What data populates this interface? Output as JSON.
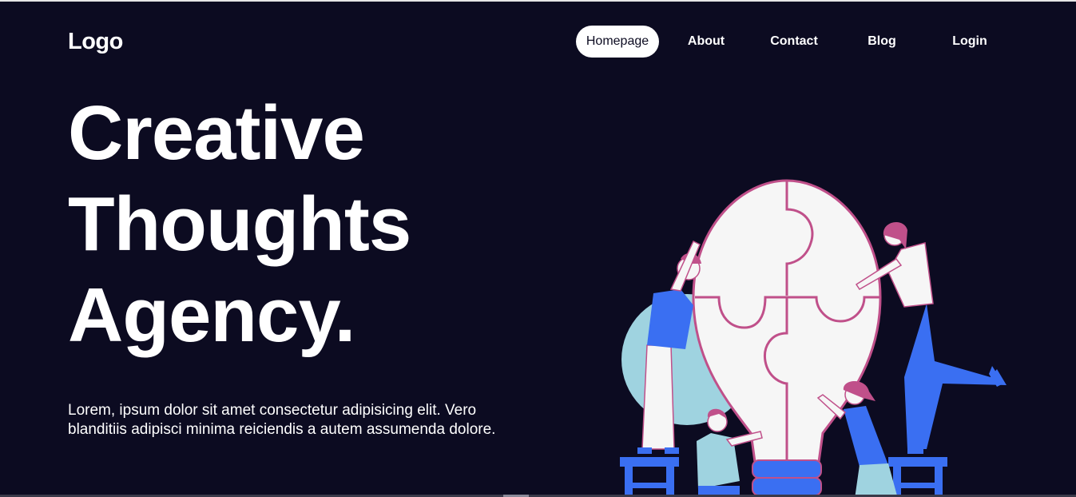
{
  "header": {
    "logo": "Logo",
    "nav": [
      {
        "label": "Homepage",
        "active": true
      },
      {
        "label": "About",
        "active": false
      },
      {
        "label": "Contact",
        "active": false
      },
      {
        "label": "Blog",
        "active": false
      },
      {
        "label": "Login",
        "active": false
      }
    ]
  },
  "hero": {
    "title_lines": [
      "Creative",
      "Thoughts",
      "Agency."
    ],
    "description": "Lorem, ipsum dolor sit amet consectetur adipisicing elit. Vero blanditiis adipisci minima reiciendis a autem assumenda dolore."
  },
  "illustration": {
    "icon": "lightbulb-puzzle-team-illustration"
  },
  "colors": {
    "background": "#0c0b21",
    "text": "#ffffff",
    "accent_blue": "#3a6ff2",
    "accent_pink": "#c0508a",
    "accent_teal": "#9fd3e0",
    "bulb": "#f6f6f6"
  }
}
